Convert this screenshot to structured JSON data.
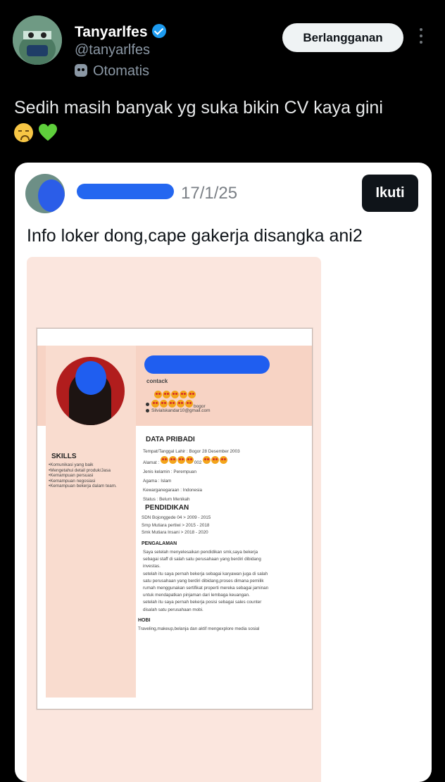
{
  "header": {
    "username": "Tanyarlfes",
    "handle": "@tanyarlfes",
    "automated_label": "Otomatis",
    "subscribe_label": "Berlangganan"
  },
  "tweet": {
    "text": "Sedih masih banyak yg suka bikin CV kaya gini"
  },
  "quote": {
    "date": "17/1/25",
    "follow_label": "Ikuti",
    "text": "Info loker dong,cape gakerja disangka ani2"
  },
  "cv": {
    "contact_label": "contack",
    "contact_city": "bogor",
    "contact_email": "Silvialskandar10@gmail.com",
    "skills_title": "SKILLS",
    "skills": [
      "•Komunikasi yang baik",
      "•Mengetahui detail produk/Jasa",
      "•Kemampuan persuasi",
      "•Kemampuan negosiasi",
      "•Kemampuan bekerja dalam team."
    ],
    "personal_title": "DATA PRIBADI",
    "personal": {
      "birth": "Tempat/Tanggal Lahir : Bogor 28 Desember 2003",
      "address": "Alamat :",
      "address_part": "002",
      "gender": "Jenis kelamin : Perempuan",
      "religion": "Agama : Islam",
      "nationality": "Kewarganegaraan : Indonesia",
      "status": "Status : Belum Menikah"
    },
    "education_title": "PENDIDIKAN",
    "education": [
      "SDN Bojonggede 04 > 2009 - 2015",
      "Smp Mutiara pertiwi > 2015 - 2018",
      "Smk Mutiara Insani > 2018 - 2020"
    ],
    "experience_title": "PENGALAMAN",
    "experience": [
      "Saya setelah menyelesaikan pendidikan smk,saya bekerja",
      "sebagai staff di salah satu perusahaan yang berdiri dibidang",
      "investas.",
      "setelah itu saya pernah bekerja sebagai karyawan juga di salah",
      "satu perusahaan yang berdiri dibidang,proses dimana pemilik",
      "rumah menggunakan sertifikat properti mereka sebagai jaminan",
      "untuk mendapatkan pinjaman dari lembaga keuangan.",
      "setelah itu saya pernah bekerja posisi sebagai sales counter",
      "disalah satu perusahaan mobi."
    ],
    "hobby_title": "HOBI",
    "hobby": "Traveling,makeup,belanja dan aktif mengexplore media sosial"
  }
}
